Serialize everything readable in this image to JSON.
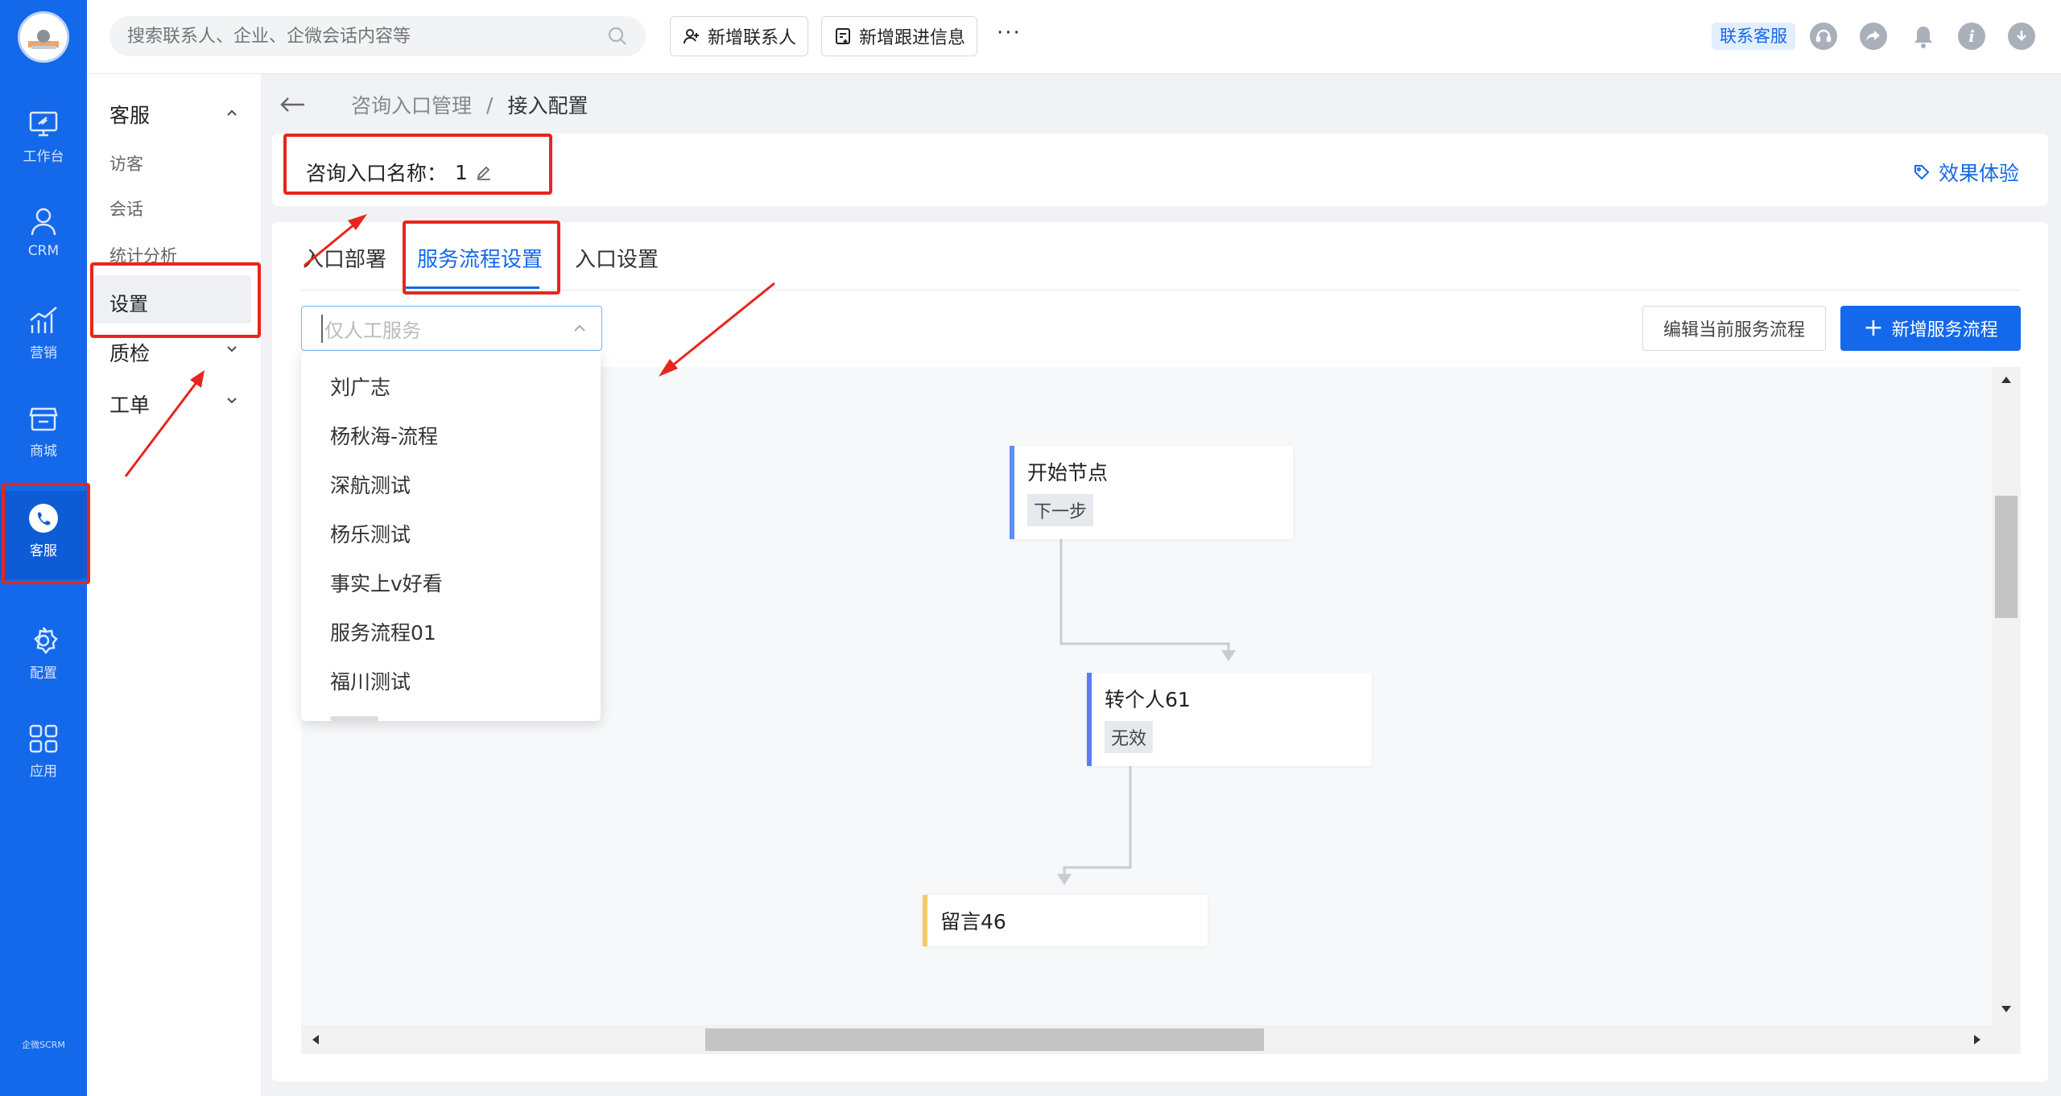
{
  "search": {
    "placeholder": "搜索联系人、企业、企微会话内容等"
  },
  "toolbar": {
    "add_contact": "新增联系人",
    "add_followup": "新增跟进信息",
    "more": "···"
  },
  "header_right": {
    "support_badge": "联系客服"
  },
  "rail": {
    "items": [
      {
        "label": "工作台",
        "icon": "monitor-icon"
      },
      {
        "label": "CRM",
        "icon": "user-icon"
      },
      {
        "label": "营销",
        "icon": "chart-icon"
      },
      {
        "label": "商城",
        "icon": "store-icon"
      },
      {
        "label": "客服",
        "icon": "headset-chat-icon"
      },
      {
        "label": "配置",
        "icon": "gear-icon"
      },
      {
        "label": "应用",
        "icon": "grid-icon"
      }
    ],
    "brand": "企微SCRM"
  },
  "submenu": {
    "group_kefu": "客服",
    "visitor": "访客",
    "session": "会话",
    "stats": "统计分析",
    "settings": "设置",
    "quality": "质检",
    "ticket": "工单"
  },
  "breadcrumb": {
    "parent": "咨询入口管理",
    "sep": "/",
    "current": "接入配置"
  },
  "entry": {
    "name_label": "咨询入口名称：",
    "name_value": "1",
    "effect": "效果体验"
  },
  "tabs": [
    "入口部署",
    "服务流程设置",
    "入口设置"
  ],
  "flow_select": {
    "placeholder": "仅人工服务"
  },
  "actions": {
    "edit_flow": "编辑当前服务流程",
    "add_flow": "新增服务流程",
    "add_icon": "+"
  },
  "dropdown_options": [
    "刘广志",
    "杨秋海-流程",
    "深航测试",
    "杨乐测试",
    "事实上v好看",
    "服务流程01",
    "福川测试"
  ],
  "flow_nodes": [
    {
      "title": "开始节点",
      "tag": "下一步",
      "color": "#5b8ff9"
    },
    {
      "title": "转个人61",
      "tag": "无效",
      "color": "#5b7cfa"
    },
    {
      "title": "留言46",
      "tag": "",
      "color": "#f5c96b"
    }
  ],
  "colors": {
    "primary": "#1468ea",
    "annotation": "#e8251c"
  }
}
